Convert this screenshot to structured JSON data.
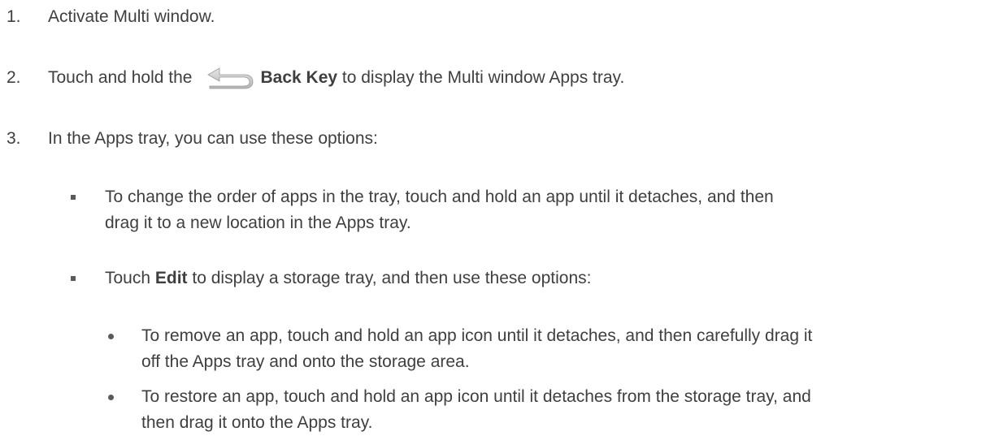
{
  "steps": [
    {
      "number": "1.",
      "text": "Activate Multi window."
    },
    {
      "number": "2.",
      "prefix": "Touch and hold the",
      "icon": "back-key-icon",
      "bold": "Back Key",
      "suffix": " to display the Multi window Apps tray."
    },
    {
      "number": "3.",
      "text": "In the Apps tray, you can use these options:"
    }
  ],
  "options": [
    {
      "line1": "To change the order of apps in the tray, touch and hold an app until it detaches, and then",
      "line2": "drag it to a new location in the Apps tray."
    },
    {
      "prefix": "Touch ",
      "bold": "Edit",
      "suffix": " to display a storage tray, and then use these options:"
    }
  ],
  "edit_options": [
    {
      "line1": "To remove an app, touch and hold an app icon until it detaches, and then carefully drag it",
      "line2": "off the Apps tray and onto the storage area."
    },
    {
      "line1": "To restore an app, touch and hold an app icon until it detaches from the storage tray, and",
      "line2": "then drag it onto the Apps tray."
    }
  ]
}
